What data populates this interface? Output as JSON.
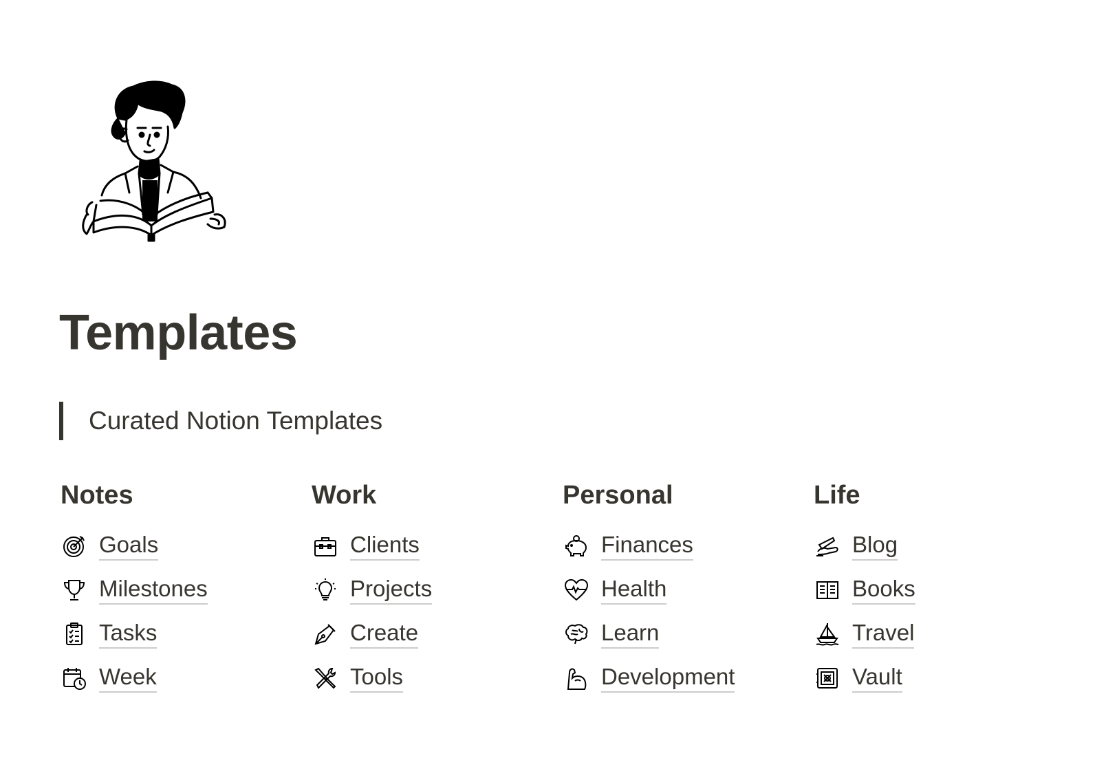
{
  "page": {
    "title": "Templates",
    "quote": "Curated Notion Templates"
  },
  "columns": [
    {
      "heading": "Notes",
      "items": [
        {
          "label": "Goals",
          "icon": "target-icon"
        },
        {
          "label": "Milestones",
          "icon": "trophy-icon"
        },
        {
          "label": "Tasks",
          "icon": "clipboard-checklist-icon"
        },
        {
          "label": "Week",
          "icon": "calendar-clock-icon"
        }
      ]
    },
    {
      "heading": "Work",
      "items": [
        {
          "label": "Clients",
          "icon": "briefcase-icon"
        },
        {
          "label": "Projects",
          "icon": "lightbulb-icon"
        },
        {
          "label": "Create",
          "icon": "pen-nib-icon"
        },
        {
          "label": "Tools",
          "icon": "wrench-screwdriver-icon"
        }
      ]
    },
    {
      "heading": "Personal",
      "items": [
        {
          "label": "Finances",
          "icon": "piggy-bank-icon"
        },
        {
          "label": "Health",
          "icon": "heartbeat-icon"
        },
        {
          "label": "Learn",
          "icon": "brain-icon"
        },
        {
          "label": "Development",
          "icon": "flexed-arm-icon"
        }
      ]
    },
    {
      "heading": "Life",
      "items": [
        {
          "label": "Blog",
          "icon": "writing-hand-icon"
        },
        {
          "label": "Books",
          "icon": "open-book-icon"
        },
        {
          "label": "Travel",
          "icon": "sailboat-icon"
        },
        {
          "label": "Vault",
          "icon": "safe-icon"
        }
      ]
    }
  ],
  "colors": {
    "text": "#37352f",
    "background": "#ffffff",
    "underline": "rgba(55,53,47,0.25)"
  }
}
